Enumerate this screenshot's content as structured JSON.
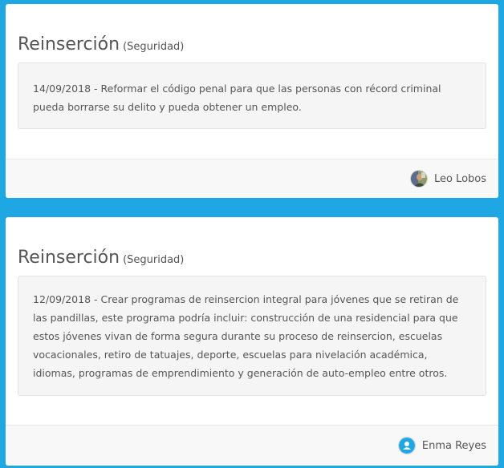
{
  "posts": [
    {
      "title": "Reinserción",
      "category": "(Seguridad)",
      "body": "14/09/2018 - Reformar el código penal para que las personas con récord criminal pueda borrarse su delito y pueda obtener un empleo.",
      "author": "Leo Lobos",
      "avatar_icon": "user-photo-icon"
    },
    {
      "title": "Reinserción",
      "category": "(Seguridad)",
      "body": "12/09/2018 - Crear programas de reinsercion integral para jóvenes que se retiran de las pandillas, este programa podría incluir: construcción de una residencial para que estos jóvenes vivan de forma segura durante su proceso de reinsercion, escuelas vocacionales, retiro de tatuajes, deporte, escuelas para nivelación académica, idiomas, programas de emprendimiento y generación de auto-empleo entre otros.",
      "author": "Enma Reyes",
      "avatar_icon": "default-user-icon"
    }
  ],
  "colors": {
    "background": "#1fa7e3",
    "default_avatar": "#1fa7e3"
  }
}
